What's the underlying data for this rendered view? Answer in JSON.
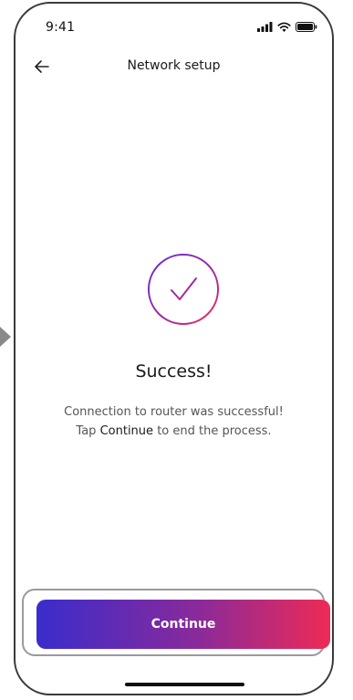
{
  "status_bar": {
    "time": "9:41",
    "icons": [
      "signal-icon",
      "wifi-icon",
      "battery-icon"
    ]
  },
  "header": {
    "back_icon": "arrow-left-icon",
    "title": "Network setup"
  },
  "result": {
    "icon": "check-circle-icon",
    "title": "Success!",
    "line1": "Connection to router was successful!",
    "line2_prefix": "Tap",
    "line2_emphasis": "Continue",
    "line2_suffix": "to end the process."
  },
  "actions": {
    "continue_label": "Continue"
  },
  "colors": {
    "gradient_start": "#3a2ccc",
    "gradient_mid": "#8a2a9a",
    "gradient_end": "#ee2a56",
    "text_primary": "#1a1a1a",
    "text_secondary": "#555555"
  }
}
